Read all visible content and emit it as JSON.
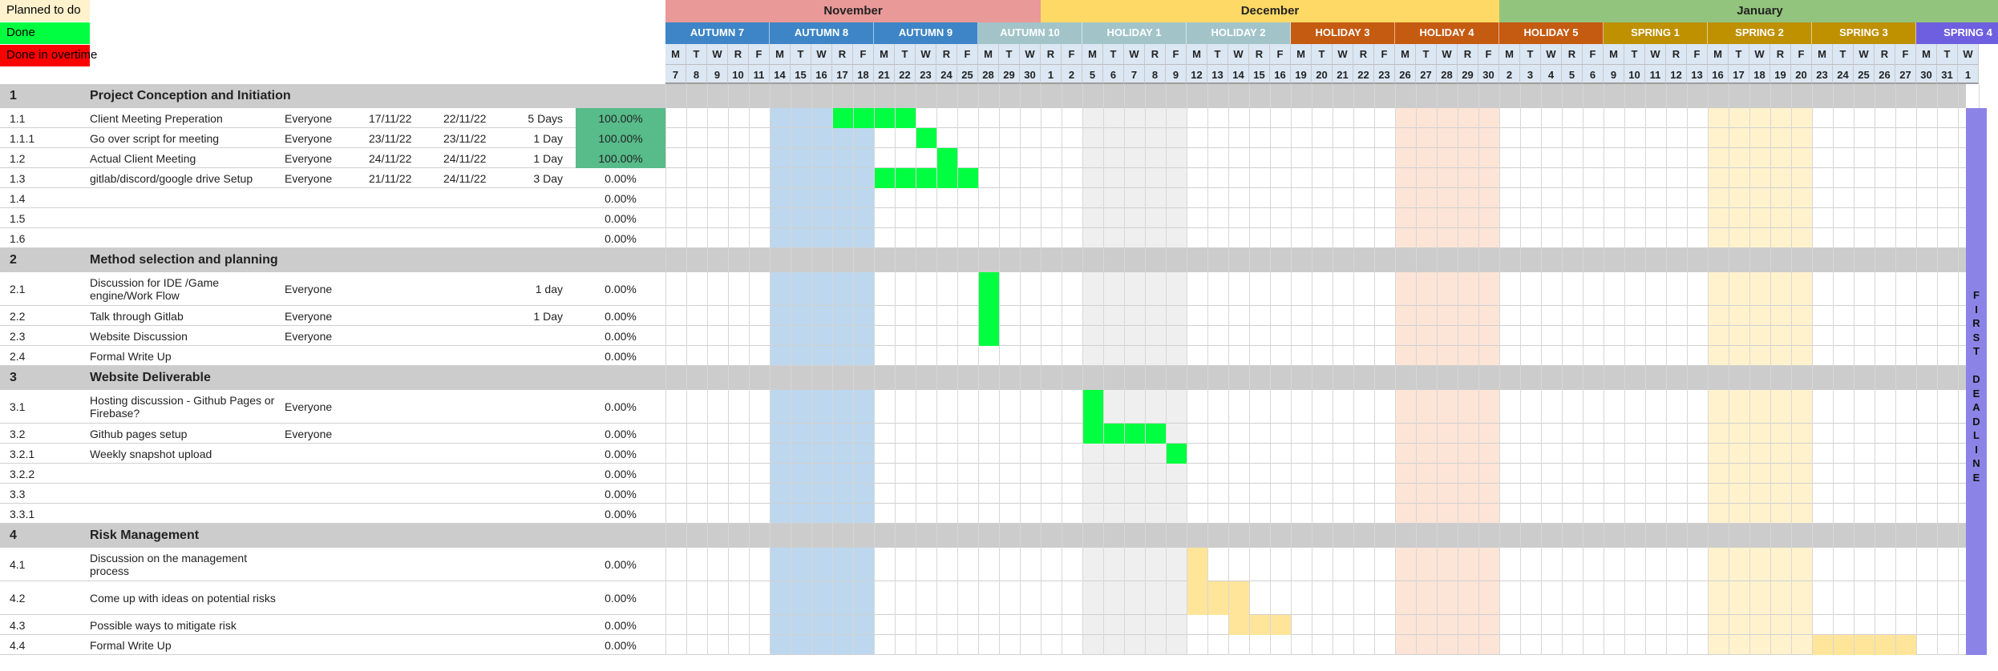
{
  "legend": {
    "planned_label": "Planned to do",
    "done_label": "Done",
    "overtime_label": "Done in overtime",
    "planned_color": "#fff2cc",
    "done_color": "#00ff40",
    "overtime_color": "#ff0000"
  },
  "months": [
    {
      "label": "November",
      "color": "#ea9999",
      "start": 0,
      "span": 18
    },
    {
      "label": "December",
      "color": "#ffd966",
      "start": 18,
      "span": 22
    },
    {
      "label": "January",
      "color": "#93c47d",
      "start": 40,
      "span": 25
    }
  ],
  "weeks": [
    {
      "label": "AUTUMN 7",
      "color": "#3d85c6"
    },
    {
      "label": "AUTUMN 8",
      "color": "#3d85c6"
    },
    {
      "label": "AUTUMN 9",
      "color": "#3d85c6"
    },
    {
      "label": "AUTUMN 10",
      "color": "#a2c4c9"
    },
    {
      "label": "HOLIDAY 1",
      "color": "#a2c4c9"
    },
    {
      "label": "HOLIDAY 2",
      "color": "#a2c4c9"
    },
    {
      "label": "HOLIDAY 3",
      "color": "#c55a11"
    },
    {
      "label": "HOLIDAY 4",
      "color": "#c55a11"
    },
    {
      "label": "HOLIDAY 5",
      "color": "#c55a11"
    },
    {
      "label": "SPRING 1",
      "color": "#bf9000"
    },
    {
      "label": "SPRING 2",
      "color": "#bf9000"
    },
    {
      "label": "SPRING 3",
      "color": "#bf9000"
    },
    {
      "label": "SPRING 4",
      "color": "#6d5fe0"
    }
  ],
  "day_letters": [
    "M",
    "T",
    "W",
    "R",
    "F"
  ],
  "dates": [
    "7",
    "8",
    "9",
    "10",
    "11",
    "14",
    "15",
    "16",
    "17",
    "18",
    "21",
    "22",
    "23",
    "24",
    "25",
    "28",
    "29",
    "30",
    "1",
    "2",
    "5",
    "6",
    "7",
    "8",
    "9",
    "12",
    "13",
    "14",
    "15",
    "16",
    "19",
    "20",
    "21",
    "22",
    "23",
    "26",
    "27",
    "28",
    "29",
    "30",
    "2",
    "3",
    "4",
    "5",
    "6",
    "9",
    "10",
    "11",
    "12",
    "13",
    "16",
    "17",
    "18",
    "19",
    "20",
    "23",
    "24",
    "25",
    "26",
    "27",
    "30",
    "31",
    "1"
  ],
  "week_shades": [
    {
      "week": 1,
      "color": "#bdd7ee"
    },
    {
      "week": 4,
      "color": "#efefef"
    },
    {
      "week": 7,
      "color": "#fce4d6"
    },
    {
      "week": 10,
      "color": "#fff2cc"
    }
  ],
  "rows": [
    {
      "type": "section",
      "id": "1",
      "title": "Project Conception and Initiation"
    },
    {
      "type": "task",
      "id": "1.1",
      "task": "Client Meeting Preperation",
      "who": "Everyone",
      "start": "17/11/22",
      "end": "22/11/22",
      "duration": "5 Days",
      "progress": "100.00%",
      "complete": true,
      "bars": [
        {
          "from": 8,
          "to": 11,
          "color": "#00ff40"
        }
      ]
    },
    {
      "type": "task",
      "id": "1.1.1",
      "task": "Go over script for meeting",
      "who": "Everyone",
      "start": "23/11/22",
      "end": "23/11/22",
      "duration": "1 Day",
      "progress": "100.00%",
      "complete": true,
      "bars": [
        {
          "from": 12,
          "to": 12,
          "color": "#00ff40"
        }
      ]
    },
    {
      "type": "task",
      "id": "1.2",
      "task": "Actual Client Meeting",
      "who": "Everyone",
      "start": "24/11/22",
      "end": "24/11/22",
      "duration": "1 Day",
      "progress": "100.00%",
      "complete": true,
      "bars": [
        {
          "from": 13,
          "to": 13,
          "color": "#00ff40"
        }
      ]
    },
    {
      "type": "task",
      "id": "1.3",
      "task": "gitlab/discord/google drive Setup",
      "who": "Everyone",
      "start": "21/11/22",
      "end": "24/11/22",
      "duration": "3 Day",
      "progress": "0.00%",
      "complete": false,
      "bars": [
        {
          "from": 10,
          "to": 14,
          "color": "#00ff40"
        }
      ]
    },
    {
      "type": "task",
      "id": "1.4",
      "task": "",
      "who": "",
      "start": "",
      "end": "",
      "duration": "",
      "progress": "0.00%",
      "complete": false,
      "bars": []
    },
    {
      "type": "task",
      "id": "1.5",
      "task": "",
      "who": "",
      "start": "",
      "end": "",
      "duration": "",
      "progress": "0.00%",
      "complete": false,
      "bars": []
    },
    {
      "type": "task",
      "id": "1.6",
      "task": "",
      "who": "",
      "start": "",
      "end": "",
      "duration": "",
      "progress": "0.00%",
      "complete": false,
      "bars": []
    },
    {
      "type": "section",
      "id": "2",
      "title": "Method selection and planning"
    },
    {
      "type": "task",
      "id": "2.1",
      "task": "Discussion for IDE /Game engine/Work Flow",
      "who": "Everyone",
      "start": "",
      "end": "",
      "duration": "1 day",
      "progress": "0.00%",
      "complete": false,
      "tall": true,
      "bars": [
        {
          "from": 15,
          "to": 15,
          "color": "#00ff40"
        }
      ]
    },
    {
      "type": "task",
      "id": "2.2",
      "task": "Talk through Gitlab",
      "who": "Everyone",
      "start": "",
      "end": "",
      "duration": "1 Day",
      "progress": "0.00%",
      "complete": false,
      "bars": [
        {
          "from": 15,
          "to": 15,
          "color": "#00ff40"
        }
      ]
    },
    {
      "type": "task",
      "id": "2.3",
      "task": "Website Discussion",
      "who": "Everyone",
      "start": "",
      "end": "",
      "duration": "",
      "progress": "0.00%",
      "complete": false,
      "bars": [
        {
          "from": 15,
          "to": 15,
          "color": "#00ff40"
        }
      ]
    },
    {
      "type": "task",
      "id": "2.4",
      "task": "Formal Write Up",
      "who": "",
      "start": "",
      "end": "",
      "duration": "",
      "progress": "0.00%",
      "complete": false,
      "bars": []
    },
    {
      "type": "section",
      "id": "3",
      "title": "Website Deliverable"
    },
    {
      "type": "task",
      "id": "3.1",
      "task": "Hosting discussion - Github Pages or Firebase?",
      "who": "Everyone",
      "start": "",
      "end": "",
      "duration": "",
      "progress": "0.00%",
      "complete": false,
      "tall": true,
      "bars": [
        {
          "from": 20,
          "to": 20,
          "color": "#00ff40"
        }
      ]
    },
    {
      "type": "task",
      "id": "3.2",
      "task": "Github pages setup",
      "who": "Everyone",
      "start": "",
      "end": "",
      "duration": "",
      "progress": "0.00%",
      "complete": false,
      "bars": [
        {
          "from": 20,
          "to": 23,
          "color": "#00ff40"
        }
      ]
    },
    {
      "type": "task",
      "id": "3.2.1",
      "task": "Weekly snapshot upload",
      "who": "",
      "start": "",
      "end": "",
      "duration": "",
      "progress": "0.00%",
      "complete": false,
      "bars": [
        {
          "from": 24,
          "to": 24,
          "color": "#00ff40"
        }
      ]
    },
    {
      "type": "task",
      "id": "3.2.2",
      "task": "",
      "who": "",
      "start": "",
      "end": "",
      "duration": "",
      "progress": "0.00%",
      "complete": false,
      "bars": []
    },
    {
      "type": "task",
      "id": "3.3",
      "task": "",
      "who": "",
      "start": "",
      "end": "",
      "duration": "",
      "progress": "0.00%",
      "complete": false,
      "bars": []
    },
    {
      "type": "task",
      "id": "3.3.1",
      "task": "",
      "who": "",
      "start": "",
      "end": "",
      "duration": "",
      "progress": "0.00%",
      "complete": false,
      "bars": []
    },
    {
      "type": "section",
      "id": "4",
      "title": "Risk Management"
    },
    {
      "type": "task",
      "id": "4.1",
      "task": "Discussion on the management process",
      "who": "",
      "start": "",
      "end": "",
      "duration": "",
      "progress": "0.00%",
      "complete": false,
      "tall": true,
      "bars": [
        {
          "from": 25,
          "to": 25,
          "color": "#ffe599"
        }
      ]
    },
    {
      "type": "task",
      "id": "4.2",
      "task": "Come up with ideas on potential risks",
      "who": "",
      "start": "",
      "end": "",
      "duration": "",
      "progress": "0.00%",
      "complete": false,
      "tall": true,
      "bars": [
        {
          "from": 25,
          "to": 27,
          "color": "#ffe599"
        }
      ]
    },
    {
      "type": "task",
      "id": "4.3",
      "task": "Possible ways to mitigate risk",
      "who": "",
      "start": "",
      "end": "",
      "duration": "",
      "progress": "0.00%",
      "complete": false,
      "bars": [
        {
          "from": 27,
          "to": 29,
          "color": "#ffe599"
        }
      ]
    },
    {
      "type": "task",
      "id": "4.4",
      "task": "Formal Write Up",
      "who": "",
      "start": "",
      "end": "",
      "duration": "",
      "progress": "0.00%",
      "complete": false,
      "bars": [
        {
          "from": 55,
          "to": 59,
          "color": "#ffe599"
        }
      ]
    }
  ],
  "deadline": {
    "label": "FIRST DEADLINE",
    "color": "#8b84e6"
  },
  "colors": {
    "section_bg": "#cccccc",
    "complete_bg": "#57bb8a",
    "grid_line": "#d7d7d7"
  }
}
